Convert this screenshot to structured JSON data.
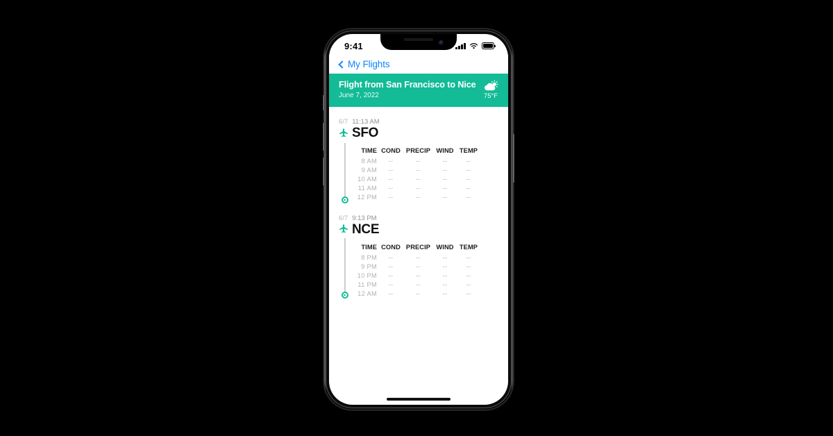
{
  "status_bar": {
    "time": "9:41",
    "signal_icon": "cellular-signal-icon",
    "wifi_icon": "wifi-icon",
    "battery_icon": "battery-icon"
  },
  "nav": {
    "back_label": "My Flights",
    "back_icon": "chevron-left-icon"
  },
  "flight_header": {
    "title": "Flight from San Francisco to Nice",
    "date": "June 7, 2022",
    "weather_icon": "sun-behind-cloud-icon",
    "temperature": "75°F",
    "accent_color": "#13bb97"
  },
  "table_headers": [
    "TIME",
    "COND",
    "PRECIP",
    "WIND",
    "TEMP"
  ],
  "legs": [
    {
      "date": "6/7",
      "time": "11:13 AM",
      "airport_code": "SFO",
      "plane_icon": "airplane-icon",
      "rows": [
        {
          "time": "8 AM",
          "cond": "--",
          "precip": "--",
          "wind": "--",
          "temp": "--"
        },
        {
          "time": "9 AM",
          "cond": "--",
          "precip": "--",
          "wind": "--",
          "temp": "--"
        },
        {
          "time": "10 AM",
          "cond": "--",
          "precip": "--",
          "wind": "--",
          "temp": "--"
        },
        {
          "time": "11 AM",
          "cond": "--",
          "precip": "--",
          "wind": "--",
          "temp": "--"
        },
        {
          "time": "12 PM",
          "cond": "--",
          "precip": "--",
          "wind": "--",
          "temp": "--"
        }
      ]
    },
    {
      "date": "6/7",
      "time": "9:13 PM",
      "airport_code": "NCE",
      "plane_icon": "airplane-icon",
      "rows": [
        {
          "time": "8 PM",
          "cond": "--",
          "precip": "--",
          "wind": "--",
          "temp": "--"
        },
        {
          "time": "9 PM",
          "cond": "--",
          "precip": "--",
          "wind": "--",
          "temp": "--"
        },
        {
          "time": "10 PM",
          "cond": "--",
          "precip": "--",
          "wind": "--",
          "temp": "--"
        },
        {
          "time": "11 PM",
          "cond": "--",
          "precip": "--",
          "wind": "--",
          "temp": "--"
        },
        {
          "time": "12 AM",
          "cond": "--",
          "precip": "--",
          "wind": "--",
          "temp": "--"
        }
      ]
    }
  ],
  "device": {
    "home_indicator": "home-indicator",
    "buttons": [
      "mute-switch",
      "volume-up-button",
      "volume-down-button",
      "power-button"
    ]
  }
}
